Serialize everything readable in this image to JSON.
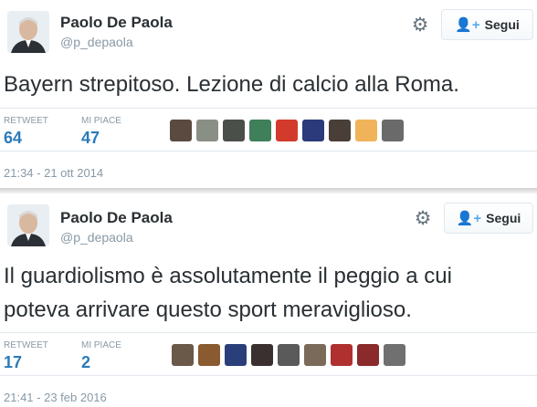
{
  "tweets": [
    {
      "name": "Paolo De Paola",
      "handle": "@p_depaola",
      "follow_label": "Segui",
      "text_lines": [
        "Bayern strepitoso. Lezione di calcio alla Roma."
      ],
      "retweet_label": "RETWEET",
      "retweet_count": "64",
      "likes_label": "MI PIACE",
      "likes_count": "47",
      "timestamp": "21:34 - 21 ott 2014",
      "liker_colors": [
        "#5a4a3f",
        "#8a8f86",
        "#4b4f4a",
        "#3f7f5a",
        "#d23b2b",
        "#2a3a7a",
        "#4a3f38",
        "#f0b35a",
        "#6a6a6a"
      ]
    },
    {
      "name": "Paolo De Paola",
      "handle": "@p_depaola",
      "follow_label": "Segui",
      "text_lines": [
        "Il guardiolismo è assolutamente il peggio a cui",
        "poteva arrivare questo sport meraviglioso."
      ],
      "retweet_label": "RETWEET",
      "retweet_count": "17",
      "likes_label": "MI PIACE",
      "likes_count": "2",
      "timestamp": "21:41 - 23 feb 2016",
      "liker_colors": [
        "#6a5848",
        "#8a5a30",
        "#2a3f7a",
        "#3a3030",
        "#5a5a5a",
        "#7a6a5a",
        "#b03030",
        "#8a2a2a",
        "#707070"
      ]
    }
  ],
  "icons": {
    "gear": "gear-icon",
    "follow": "person-plus-icon"
  }
}
